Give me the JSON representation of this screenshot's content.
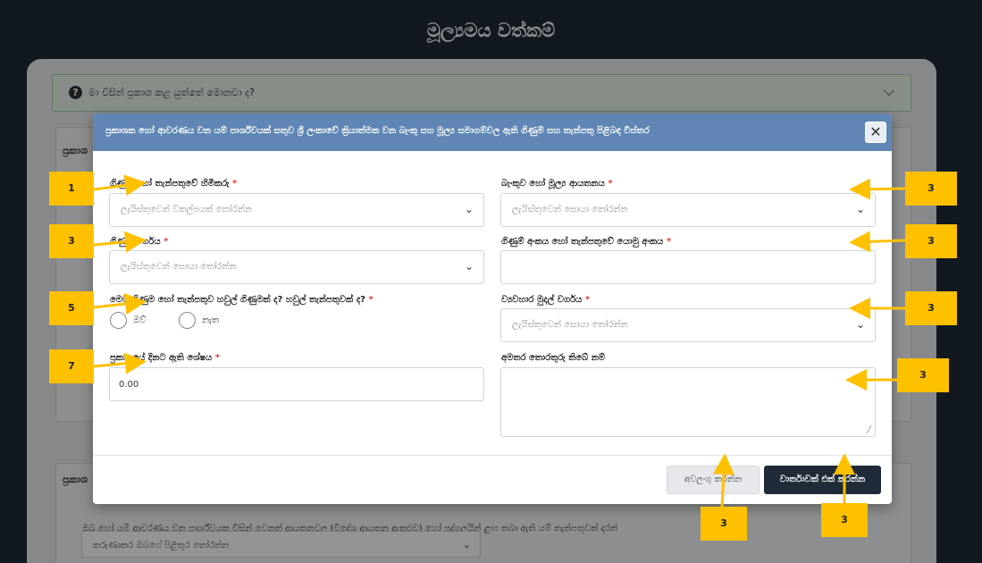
{
  "page": {
    "title": "මූල්‍යමය වත්කම්"
  },
  "faq": {
    "question": "මා විසින් ප්‍රකාශ කළ යුත්තේ මොනවා ද?"
  },
  "background": {
    "section1_label": "ප්‍රකාශ",
    "section2_label": "ප්‍රකාශ",
    "section2_desc": "ඔබ හෝ යම් ආවරණය වන පාර්ශ්වයක විසින් වෙනත් ආයතනවල (විදේශ ආයතන ඇතුළුව) හෝ පුද්ගලයින් ළඟ තබා ඇති යම් තැන්පතුවක් දරන්",
    "section2_select": "කරුණාකර ඔබගේ පිළිතුර තෝරන්න"
  },
  "modal": {
    "title": "ප්‍රකාශක හෝ ආවරණය වන යම් පාර්ශ්වයක් සතුව ශ්‍රී ලංකාවේ ක්‍රියාත්මක වන බැංකු සහ මූල්‍ය සමාගම්වල ඇති ගිණුම් සහ තැන්පතු පිළිබඳ විස්තර",
    "close_icon": "close-icon",
    "fields": {
      "holder": {
        "label": "ගිණුම් හෝ තැන්පතුවේ හිමිකරු",
        "required": "*",
        "placeholder": "ලැයිස්තුවෙන් විකල්පයක් තෝරන්න"
      },
      "bank": {
        "label": "බැංකුව හෝ මූල්‍ය ආයතනය",
        "required": "*",
        "placeholder": "ලැයිස්තුවෙන් සොයා තෝරන්න"
      },
      "account_type": {
        "label": "ගිණුම් වර්ගය",
        "required": "*",
        "placeholder": "ලැයිස්තුවෙන් සොයා තෝරන්න"
      },
      "account_number": {
        "label": "ගිණුම් අංකය හෝ තැන්පතුවේ යොමු අංකය",
        "required": "*",
        "value": ""
      },
      "joint": {
        "label": "මෙම ගිණුම හෝ තැන්පතුව හවුල් ගිණුමක් ද? හවුල් තැන්පතුවක් ද?",
        "required": "*",
        "options": [
          "ඔව්",
          "නැත"
        ]
      },
      "currency": {
        "label": "ව්‍යවහාර මුදල් වර්ගය",
        "required": "*",
        "placeholder": "ලැයිස්තුවෙන් සොයා තෝරන්න"
      },
      "balance": {
        "label": "ප්‍රකාශයේ දිනට ඇති ශේෂය",
        "required": "*",
        "value": "0.00"
      },
      "notes": {
        "label": "අමතර තොරතුරු තිබේ නම්",
        "value": ""
      }
    },
    "buttons": {
      "cancel": "අවලංගු කරන්න",
      "submit": "වාර්තාවක් එක් කරන්න"
    }
  },
  "annotations": [
    "1",
    "3",
    "3",
    "3",
    "5",
    "3",
    "7",
    "3",
    "3",
    "3"
  ],
  "colors": {
    "header": "#1e2a38",
    "modal_header": "#5f86b4",
    "badge": "#ffc000",
    "required": "#e53935",
    "submit_button": "#1f2b38"
  }
}
